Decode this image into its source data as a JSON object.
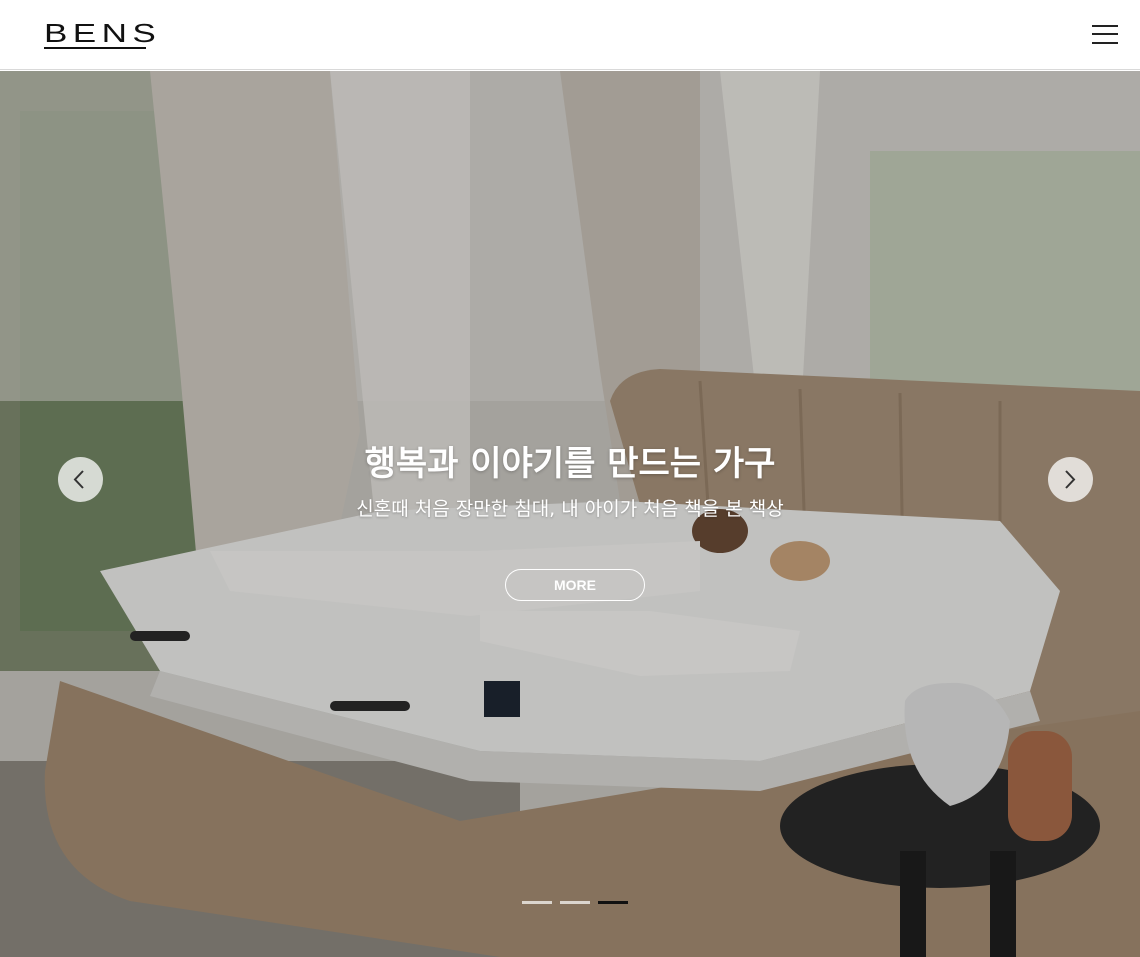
{
  "header": {
    "logo_text": "BENS",
    "menu_icon": "hamburger-menu-icon"
  },
  "hero": {
    "title": "행복과 이야기를 만드는 가구",
    "subtitle": "신혼때 처음 장만한 침대, 내 아이가 처음 책을 본 책상",
    "more_label": "MORE",
    "prev_icon": "chevron-left-icon",
    "next_icon": "chevron-right-icon",
    "slides_total": 3,
    "active_slide": 3
  },
  "colors": {
    "header_bg": "#ffffff",
    "pager_active": "#111111",
    "pager_inactive": "#e6e6e6",
    "hero_text": "#ffffff"
  }
}
